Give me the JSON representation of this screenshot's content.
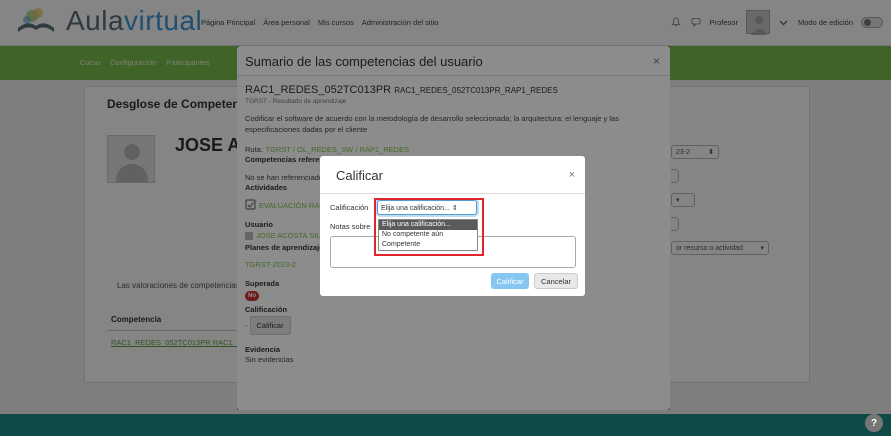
{
  "navbar": {
    "logo_part1": "Aula",
    "logo_part2": "virtual",
    "links": [
      "Página Principal",
      "Área personal",
      "Mis cursos",
      "Administración del sitio"
    ],
    "user_name": "Profesor",
    "edit_mode_label": "Modo de edición"
  },
  "subnav": {
    "items": [
      "Curso",
      "Configuración",
      "Participantes"
    ]
  },
  "background": {
    "card_title": "Desglose de Competencias",
    "user_name": "JOSE ACOSTA",
    "valoraciones_text": "Las valoraciones de competencias",
    "table_header": "Competencia",
    "table_cell": "RAC1_REDES_052TC013PR RAC1_REDES",
    "select_year": "23-2",
    "select_filter": "or recurso o actividad"
  },
  "summary": {
    "title": "Sumario de las competencias del usuario",
    "close_symbol": "×",
    "code_main": "RAC1_REDES_052TC013PR",
    "code_rest": "RAC1_REDES_052TC013PR_RAP1_REDES",
    "subtitle": "TGRST - Resultado de aprendizaje",
    "description": "Codificar el software de acuerdo con la metodología de desarrollo seleccionada; la arquitectura; el lenguaje y las especificaciones dadas por el cliente",
    "ruta_label": "Ruta:",
    "ruta_value": "TGRST / OL_REDES_SW / RAP1_REDES",
    "referenced_label": "Competencias referenciadas",
    "referenced_text": "No se han referenciado",
    "activities_label": "Actividades",
    "activity_link": "EVALUACIÓN RAC",
    "usuario_label": "Usuario",
    "usuario_value": "JOSE ACOSTA SILVA",
    "planes_label": "Planes de aprendizaje",
    "planes_value": "TGRST-2023-2",
    "superada_label": "Superada",
    "superada_badge": "No",
    "calificacion_label": "Calificación",
    "calificacion_dash": "-",
    "calificar_button": "Calificar",
    "evidencia_label": "Evidencia",
    "evidencia_text": "Sin evidencias"
  },
  "calificar_dialog": {
    "title": "Calificar",
    "close_symbol": "×",
    "grade_label": "Calificación",
    "notes_label": "Notas sobre",
    "select_value": "Elija una calificación... ⇕",
    "options": [
      "Elija una calificación...",
      "No competente aún",
      "Competente"
    ],
    "primary_button": "Calificar",
    "cancel_button": "Cancelar"
  },
  "help_symbol": "?",
  "colors": {
    "brand_green": "#7bc04b",
    "logo_blue": "#3c9ad8",
    "highlight_red": "#e0262a",
    "footer_teal": "#1e8f86"
  }
}
